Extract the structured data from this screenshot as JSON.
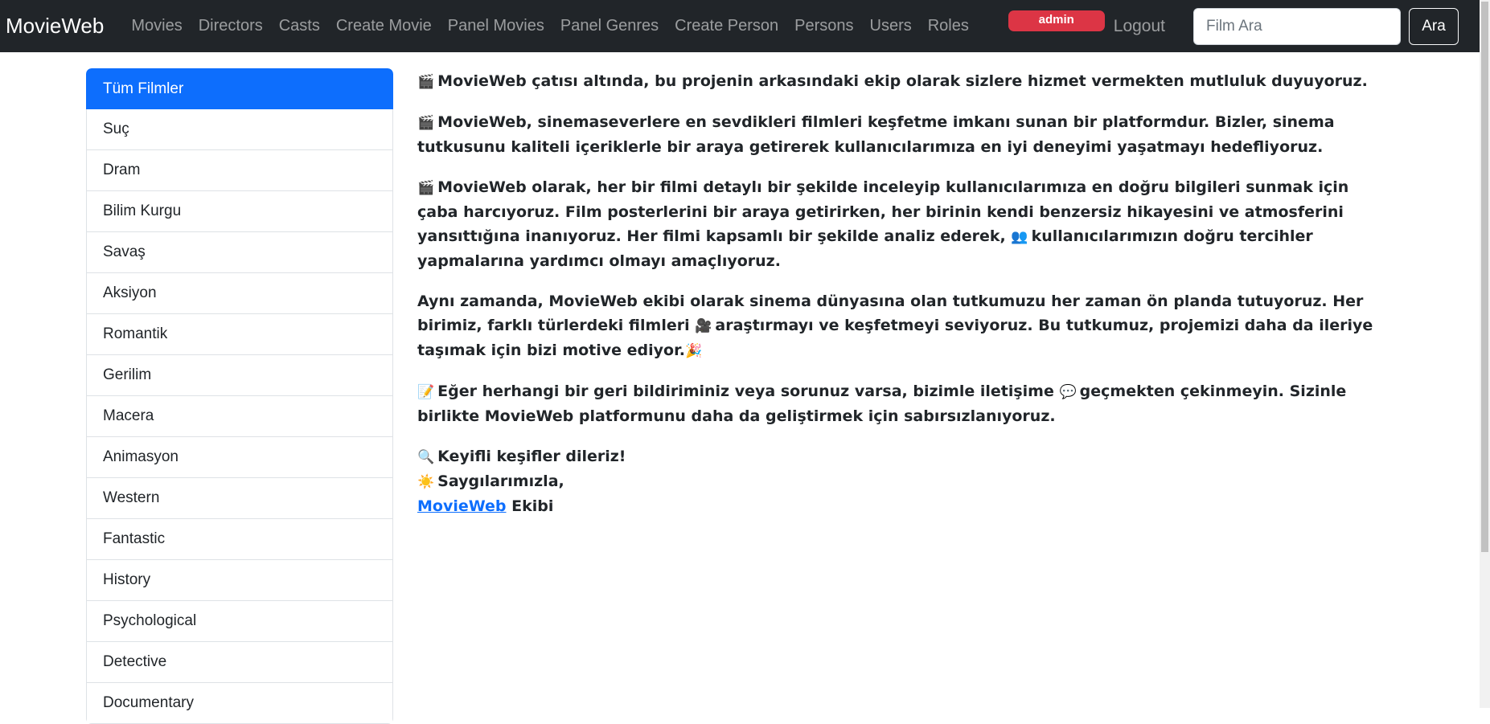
{
  "navbar": {
    "brand": "MovieWeb",
    "links": [
      "Movies",
      "Directors",
      "Casts",
      "Create Movie",
      "Panel Movies",
      "Panel Genres",
      "Create Person",
      "Persons",
      "Users",
      "Roles"
    ],
    "admin_badge": "admin",
    "logout": "Logout",
    "search_placeholder": "Film Ara",
    "search_button": "Ara"
  },
  "sidebar": {
    "items": [
      "Tüm Filmler",
      "Suç",
      "Dram",
      "Bilim Kurgu",
      "Savaş",
      "Aksiyon",
      "Romantik",
      "Gerilim",
      "Macera",
      "Animasyon",
      "Western",
      "Fantastic",
      "History",
      "Psychological",
      "Detective",
      "Documentary"
    ],
    "active_index": 0
  },
  "content": {
    "p1": "MovieWeb çatısı altında, bu projenin arkasındaki ekip olarak sizlere hizmet vermekten mutluluk duyuyoruz.",
    "p2": "MovieWeb, sinemaseverlere en sevdikleri filmleri keşfetme imkanı sunan bir platformdur. Bizler, sinema tutkusunu kaliteli içeriklerle bir araya getirerek kullanıcılarımıza en iyi deneyimi yaşatmayı hedefliyoruz.",
    "p3a": "MovieWeb olarak, her bir filmi detaylı bir şekilde inceleyip kullanıcılarımıza en doğru bilgileri sunmak için çaba harcıyoruz. Film posterlerini bir araya getirirken, her birinin kendi benzersiz hikayesini ve atmosferini yansıttığına inanıyoruz. Her filmi kapsamlı bir şekilde analiz ederek,",
    "p3b": "kullanıcılarımızın doğru tercihler yapmalarına yardımcı olmayı amaçlıyoruz.",
    "p4a": "Aynı zamanda, MovieWeb ekibi olarak sinema dünyasına olan tutkumuzu her zaman ön planda tutuyoruz. Her birimiz, farklı türlerdeki filmleri",
    "p4b": "araştırmayı ve keşfetmeyi seviyoruz. Bu tutkumuz, projemizi daha da ileriye taşımak için bizi motive ediyor.",
    "p5a": "Eğer herhangi bir geri bildiriminiz veya sorunuz varsa, bizimle iletişime",
    "p5b": "geçmekten çekinmeyin. Sizinle birlikte MovieWeb platformunu daha da geliştirmek için sabırsızlanıyoruz.",
    "closing1": "Keyifli keşifler dileriz!",
    "closing2": "Saygılarımızla,",
    "closing_link": "MovieWeb",
    "closing3": "Ekibi"
  },
  "icons": {
    "clapper": "clapper-icon",
    "people": "people-icon",
    "camera": "film-camera-icon",
    "party": "party-popper-icon",
    "memo": "memo-icon",
    "speech": "speech-bubble-icon",
    "search": "magnifier-icon",
    "sun": "sun-icon"
  },
  "colors": {
    "navbar_bg": "#212529",
    "active_item": "#0d6efd",
    "admin_badge": "#dc3545",
    "link": "#0d6efd"
  }
}
